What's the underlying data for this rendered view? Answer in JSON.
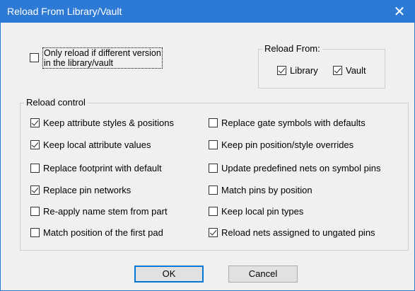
{
  "dialog": {
    "title": "Reload From Library/Vault",
    "close_glyph": "✕"
  },
  "only_reload": {
    "line1": "Only reload if different version",
    "line2": "in the library/vault",
    "checked": false
  },
  "reload_from": {
    "label": "Reload From:",
    "library": {
      "label": "Library",
      "checked": true
    },
    "vault": {
      "label": "Vault",
      "checked": true
    }
  },
  "reload_control": {
    "label": "Reload control",
    "left": [
      {
        "label": "Keep attribute styles & positions",
        "checked": true
      },
      {
        "label": "Keep local attribute values",
        "checked": true
      },
      {
        "label": "Replace footprint with default",
        "checked": false
      },
      {
        "label": "Replace pin networks",
        "checked": true
      },
      {
        "label": "Re-apply name stem from part",
        "checked": false
      },
      {
        "label": "Match position of the first pad",
        "checked": false
      }
    ],
    "right": [
      {
        "label": "Replace gate symbols with defaults",
        "checked": false
      },
      {
        "label": "Keep pin position/style overrides",
        "checked": false
      },
      {
        "label": "Update predefined nets on symbol pins",
        "checked": false
      },
      {
        "label": "Match pins by position",
        "checked": false
      },
      {
        "label": "Keep local pin types",
        "checked": false
      },
      {
        "label": "Reload nets assigned to ungated pins",
        "checked": true
      }
    ]
  },
  "buttons": {
    "ok": "OK",
    "cancel": "Cancel"
  },
  "colors": {
    "titlebar": "#2c7ad6",
    "dialog_bg": "#f0f0f0"
  }
}
